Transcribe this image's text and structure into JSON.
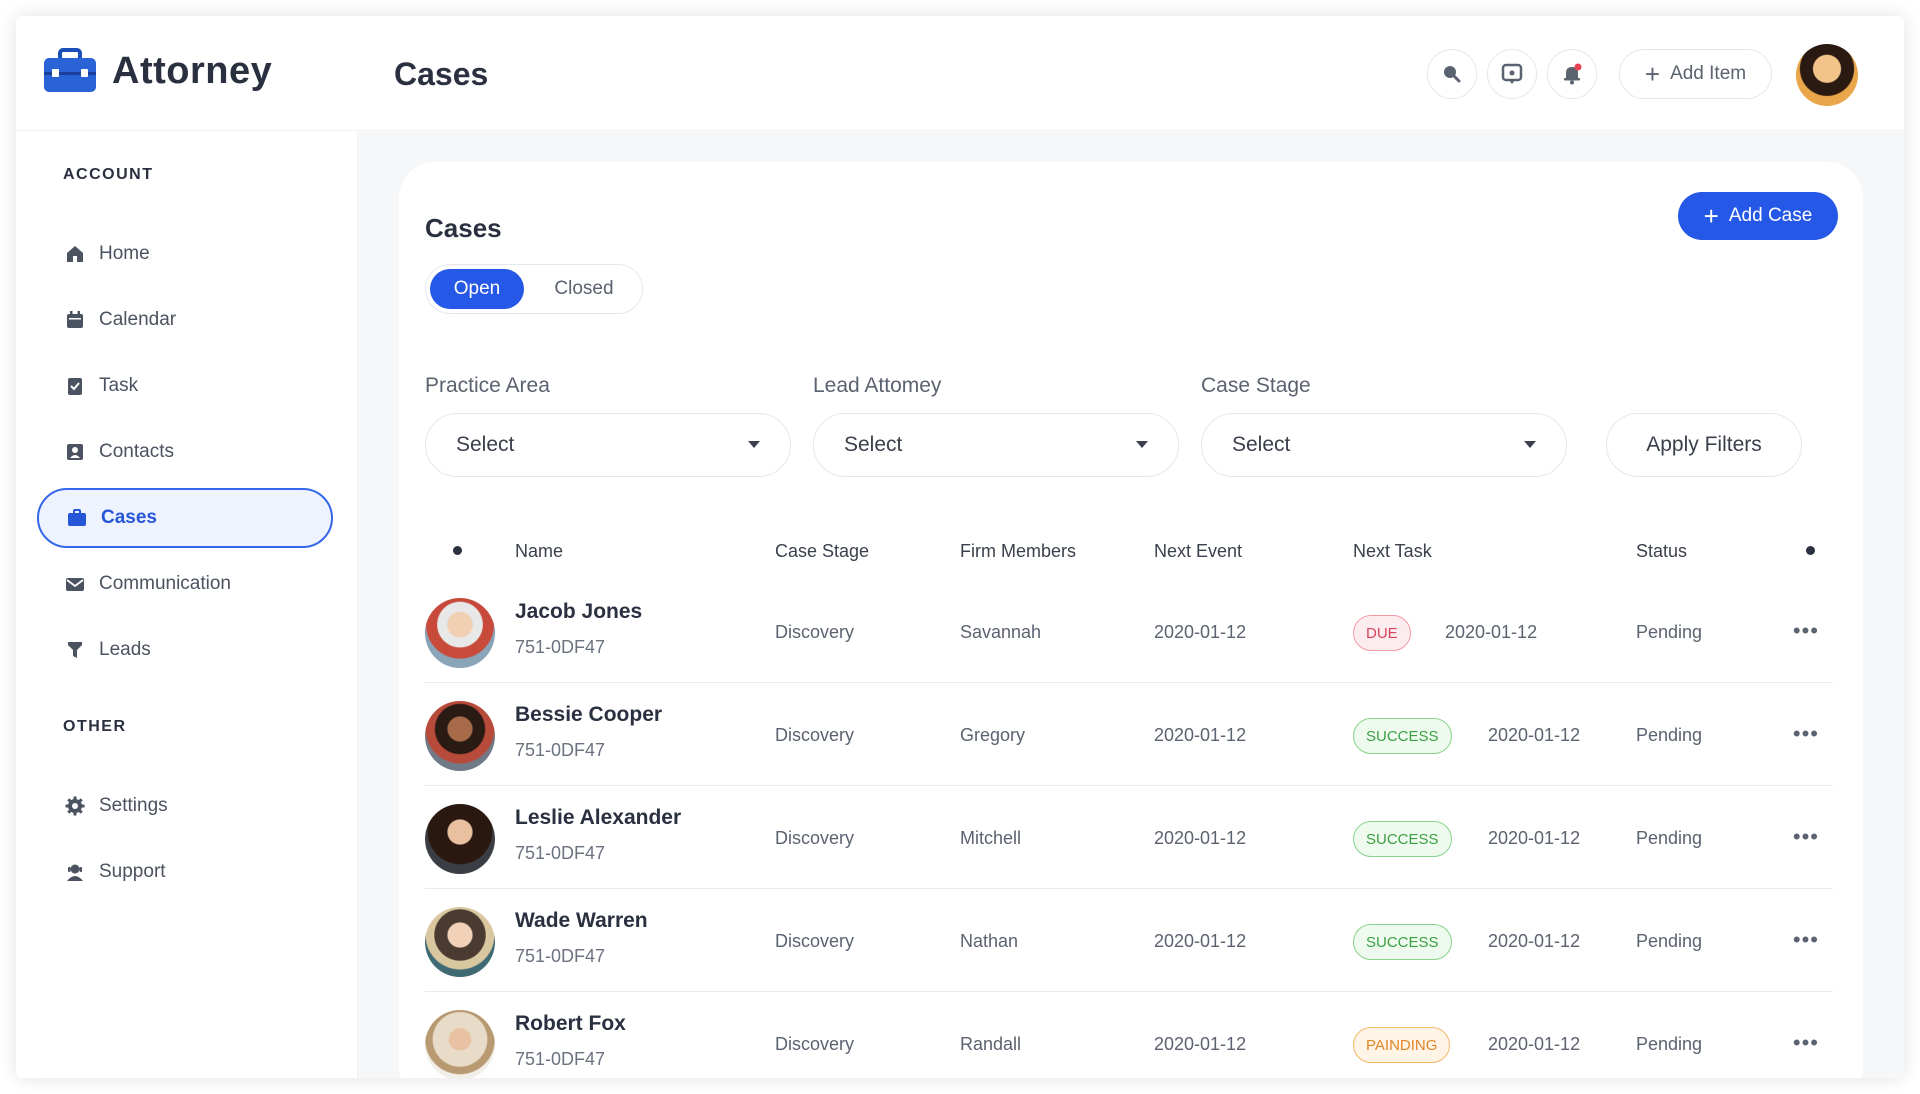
{
  "app": {
    "brand": "Attorney",
    "page_title": "Cases"
  },
  "topbar": {
    "icons": [
      "search-icon",
      "chat-icon",
      "bell-icon"
    ],
    "add_item_label": "Add Item"
  },
  "sidebar": {
    "account_label": "ACCOUNT",
    "account_items": [
      {
        "label": "Home",
        "icon": "home-icon"
      },
      {
        "label": "Calendar",
        "icon": "calendar-icon"
      },
      {
        "label": "Task",
        "icon": "task-icon"
      },
      {
        "label": "Contacts",
        "icon": "contacts-icon"
      },
      {
        "label": "Cases",
        "icon": "briefcase-icon",
        "active": true
      },
      {
        "label": "Communication",
        "icon": "mail-icon"
      },
      {
        "label": "Leads",
        "icon": "funnel-icon"
      }
    ],
    "other_label": "OTHER",
    "other_items": [
      {
        "label": "Settings",
        "icon": "gear-icon"
      },
      {
        "label": "Support",
        "icon": "support-icon"
      }
    ]
  },
  "main": {
    "title": "Cases",
    "add_case_label": "Add Case",
    "tabs": {
      "open": "Open",
      "closed": "Closed",
      "active": "open"
    },
    "filters": [
      {
        "label": "Practice Area",
        "value": "Select"
      },
      {
        "label": "Lead Attomey",
        "value": "Select"
      },
      {
        "label": "Case Stage",
        "value": "Select"
      }
    ],
    "apply_label": "Apply Filters",
    "table": {
      "columns": [
        "Name",
        "Case Stage",
        "Firm Members",
        "Next Event",
        "Next Task",
        "Status"
      ],
      "rows": [
        {
          "name": "Jacob Jones",
          "id": "751-0DF47",
          "stage": "Discovery",
          "member": "Savannah",
          "event": "2020-01-12",
          "badge": "DUE",
          "badge_type": "due",
          "task_date": "2020-01-12",
          "status": "Pending"
        },
        {
          "name": "Bessie Cooper",
          "id": "751-0DF47",
          "stage": "Discovery",
          "member": "Gregory",
          "event": "2020-01-12",
          "badge": "SUCCESS",
          "badge_type": "success",
          "task_date": "2020-01-12",
          "status": "Pending"
        },
        {
          "name": "Leslie Alexander",
          "id": "751-0DF47",
          "stage": "Discovery",
          "member": "Mitchell",
          "event": "2020-01-12",
          "badge": "SUCCESS",
          "badge_type": "success",
          "task_date": "2020-01-12",
          "status": "Pending"
        },
        {
          "name": "Wade Warren",
          "id": "751-0DF47",
          "stage": "Discovery",
          "member": "Nathan",
          "event": "2020-01-12",
          "badge": "SUCCESS",
          "badge_type": "success",
          "task_date": "2020-01-12",
          "status": "Pending"
        },
        {
          "name": "Robert Fox",
          "id": "751-0DF47",
          "stage": "Discovery",
          "member": "Randall",
          "event": "2020-01-12",
          "badge": "PAINDING",
          "badge_type": "painding",
          "task_date": "2020-01-12",
          "status": "Pending"
        }
      ]
    }
  },
  "colors": {
    "accent": "#2558e6",
    "due": "#d9435a",
    "success": "#3aa043",
    "painding": "#e0862a"
  }
}
